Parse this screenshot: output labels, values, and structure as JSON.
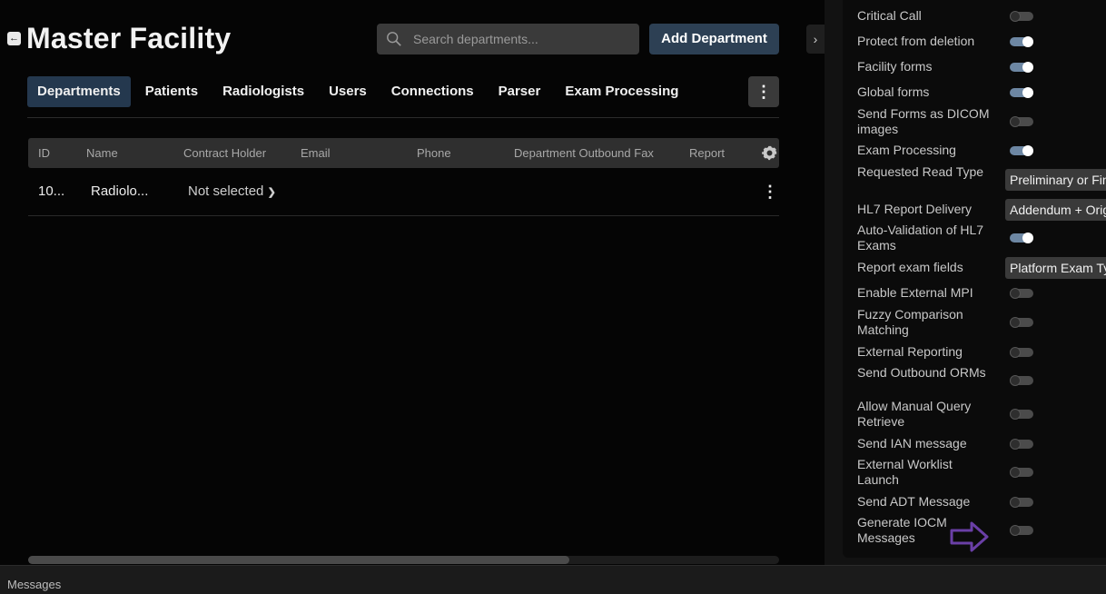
{
  "header": {
    "title": "Master Facility",
    "search_placeholder": "Search departments...",
    "add_button": "Add Department"
  },
  "tabs": [
    {
      "label": "Departments",
      "active": true
    },
    {
      "label": "Patients"
    },
    {
      "label": "Radiologists"
    },
    {
      "label": "Users"
    },
    {
      "label": "Connections"
    },
    {
      "label": "Parser"
    },
    {
      "label": "Exam Processing"
    }
  ],
  "table": {
    "columns": [
      "ID",
      "Name",
      "Contract Holder",
      "Email",
      "Phone",
      "Department Outbound Fax",
      "Report"
    ],
    "rows": [
      {
        "id": "10...",
        "name": "Radiolo...",
        "contract_holder": "Not selected"
      }
    ]
  },
  "settings": [
    {
      "label": "Critical Call",
      "type": "toggle",
      "on": false
    },
    {
      "label": "Protect from deletion",
      "type": "toggle",
      "on": true
    },
    {
      "label": "Facility forms",
      "type": "toggle",
      "on": true
    },
    {
      "label": "Global forms",
      "type": "toggle",
      "on": true
    },
    {
      "label": "Send Forms as DICOM images",
      "type": "toggle",
      "on": false
    },
    {
      "label": "Exam Processing",
      "type": "toggle",
      "on": true
    },
    {
      "label": "Requested Read Type",
      "type": "select",
      "value": "Preliminary or Final"
    },
    {
      "label": "HL7 Report Delivery",
      "type": "select",
      "value": "Addendum + Original"
    },
    {
      "label": "Auto-Validation of HL7 Exams",
      "type": "toggle",
      "on": true
    },
    {
      "label": "Report exam fields",
      "type": "select",
      "value": "Platform Exam Type"
    },
    {
      "label": "Enable External MPI",
      "type": "toggle",
      "on": false
    },
    {
      "label": "Fuzzy Comparison Matching",
      "type": "toggle",
      "on": false
    },
    {
      "label": "External Reporting",
      "type": "toggle",
      "on": false
    },
    {
      "label": "Send Outbound ORMs",
      "type": "toggle",
      "on": false
    },
    {
      "label": "Allow Manual Query Retrieve",
      "type": "toggle",
      "on": false
    },
    {
      "label": "Send IAN message",
      "type": "toggle",
      "on": false
    },
    {
      "label": "External Worklist Launch",
      "type": "toggle",
      "on": false
    },
    {
      "label": "Send ADT Message",
      "type": "toggle",
      "on": false
    },
    {
      "label": "Generate IOCM Messages",
      "type": "toggle",
      "on": false
    }
  ],
  "annotation": {
    "icon": "arrow-right-icon",
    "color": "#6a3fa6"
  },
  "footer": {
    "label": "Messages"
  }
}
